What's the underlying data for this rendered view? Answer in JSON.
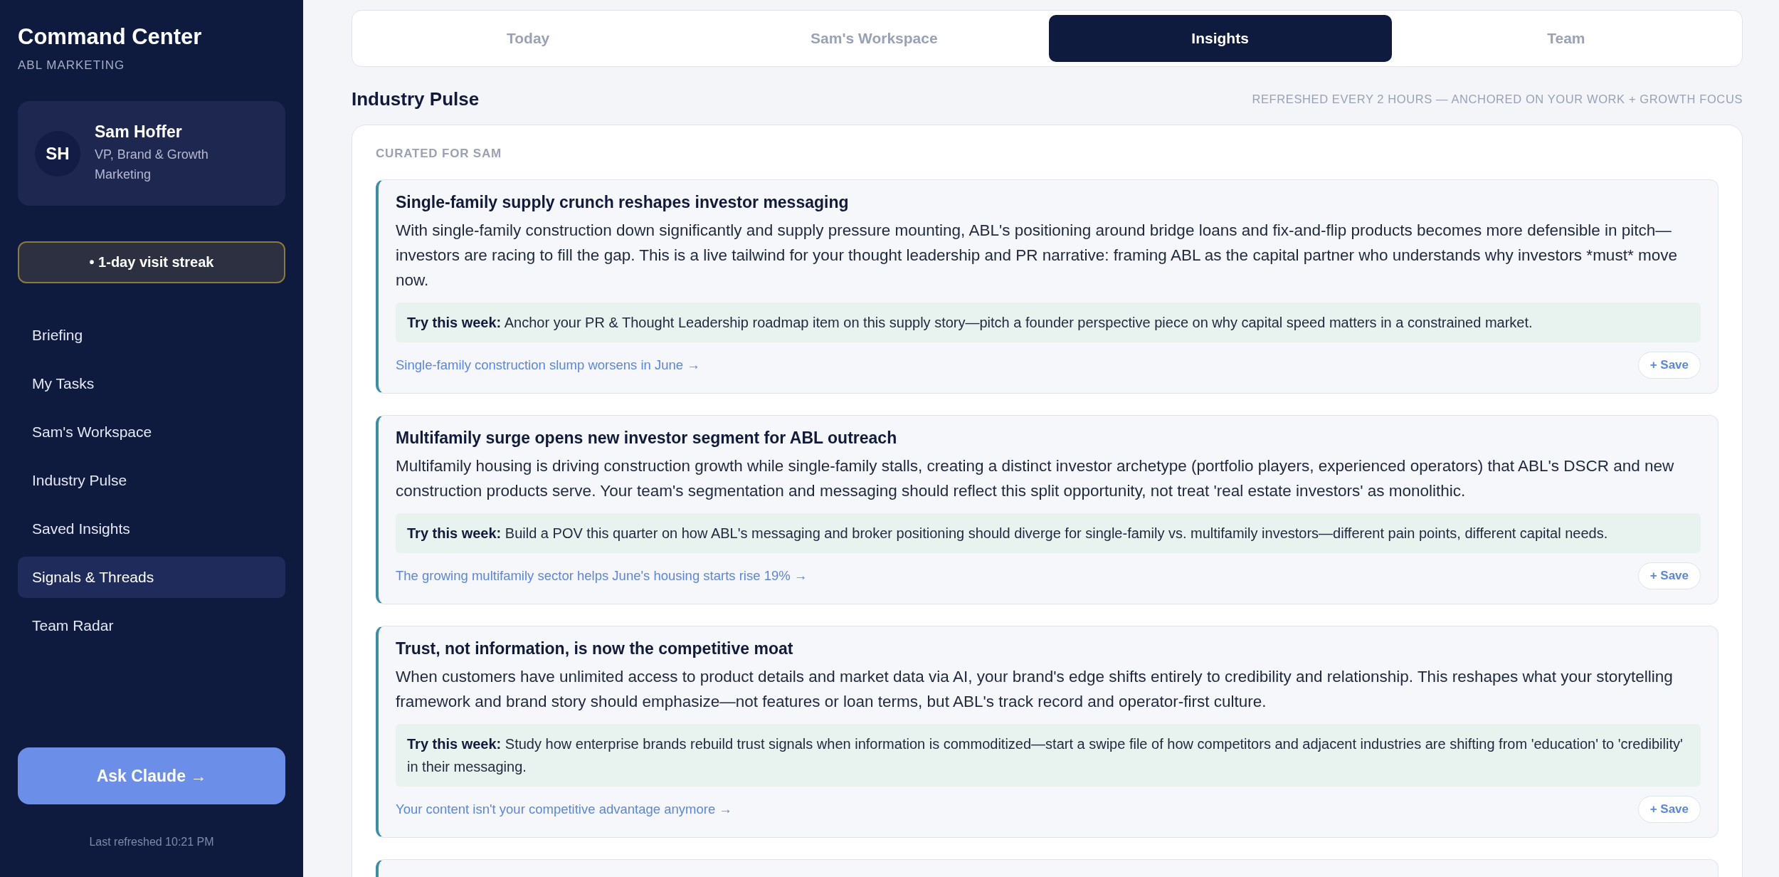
{
  "sidebar": {
    "title": "Command Center",
    "subtitle": "ABL MARKETING",
    "profile": {
      "initials": "SH",
      "name": "Sam Hoffer",
      "role": "VP, Brand & Growth Marketing"
    },
    "streak": "• 1-day visit streak",
    "items": [
      {
        "label": "Briefing",
        "selected": false
      },
      {
        "label": "My Tasks",
        "selected": false
      },
      {
        "label": "Sam's Workspace",
        "selected": false
      },
      {
        "label": "Industry Pulse",
        "selected": false
      },
      {
        "label": "Saved Insights",
        "selected": false
      },
      {
        "label": "Signals & Threads",
        "selected": true
      },
      {
        "label": "Team Radar",
        "selected": false
      }
    ],
    "ask_button": "Ask Claude →",
    "last_refreshed": "Last refreshed 10:21 PM"
  },
  "tabs": [
    {
      "label": "Today",
      "selected": false
    },
    {
      "label": "Sam's Workspace",
      "selected": false
    },
    {
      "label": "Insights",
      "selected": true
    },
    {
      "label": "Team",
      "selected": false
    }
  ],
  "section": {
    "title": "Industry Pulse",
    "note": "REFRESHED EVERY 2 HOURS — ANCHORED ON YOUR WORK + GROWTH FOCUS",
    "panel_label": "CURATED FOR SAM",
    "insights": [
      {
        "title": "Single-family supply crunch reshapes investor messaging",
        "body": "With single-family construction down significantly and supply pressure mounting, ABL's positioning around bridge loans and fix-and-flip products becomes more defensible in pitch—investors are racing to fill the gap. This is a live tailwind for your thought leadership and PR narrative: framing ABL as the capital partner who understands why investors *must* move now.",
        "try": "**Try this week:** Anchor your PR & Thought Leadership roadmap item on this supply story—pitch a founder perspective piece on why capital speed matters in a constrained market.",
        "link": "Single-family construction slump worsens in June →",
        "save": "+ Save"
      },
      {
        "title": "Multifamily surge opens new investor segment for ABL outreach",
        "body": "Multifamily housing is driving construction growth while single-family stalls, creating a distinct investor archetype (portfolio players, experienced operators) that ABL's DSCR and new construction products serve. Your team's segmentation and messaging should reflect this split opportunity, not treat 'real estate investors' as monolithic.",
        "try": "**Try this week:** Build a POV this quarter on how ABL's messaging and broker positioning should diverge for single-family vs. multifamily investors—different pain points, different capital needs.",
        "link": "The growing multifamily sector helps June's housing starts rise 19% →",
        "save": "+ Save"
      },
      {
        "title": "Trust, not information, is now the competitive moat",
        "body": "When customers have unlimited access to product details and market data via AI, your brand's edge shifts entirely to credibility and relationship. This reshapes what your storytelling framework and brand story should emphasize—not features or loan terms, but ABL's track record and operator-first culture.",
        "try": "**Try this week:** Study how enterprise brands rebuild trust signals when information is commoditized—start a swipe file of how competitors and adjacent industries are shifting from 'education' to 'credibility' in their messaging.",
        "link": "Your content isn't your competitive advantage anymore →",
        "save": "+ Save"
      }
    ],
    "more_below": true
  }
}
